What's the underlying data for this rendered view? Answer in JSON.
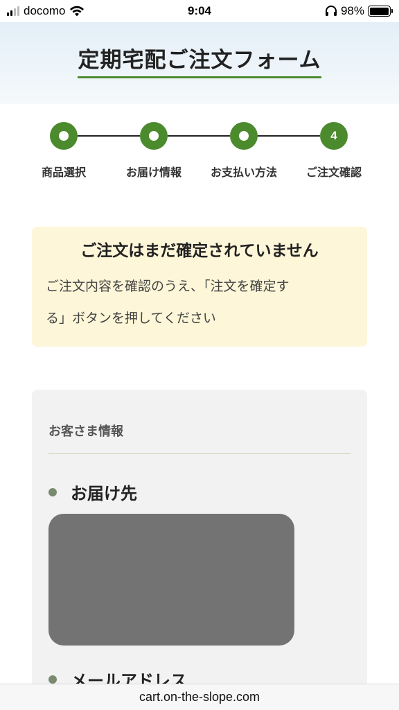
{
  "status_bar": {
    "carrier": "docomo",
    "time": "9:04",
    "battery_percent": "98%",
    "battery_level": 0.98,
    "signal_icon": "signal-bars-icon",
    "wifi_icon": "wifi-icon",
    "headphones_icon": "headphones-icon",
    "battery_icon": "battery-icon"
  },
  "header": {
    "title": "定期宅配ご注文フォーム"
  },
  "steps": [
    {
      "label": "商品選択",
      "state": "completed"
    },
    {
      "label": "お届け情報",
      "state": "completed"
    },
    {
      "label": "お支払い方法",
      "state": "completed"
    },
    {
      "label": "ご注文確認",
      "state": "current",
      "number": "4"
    }
  ],
  "notice": {
    "title": "ご注文はまだ確定されていません",
    "line1": "ご注文内容を確認のうえ、「注文を確定す",
    "line2": "る」ボタンを押してください"
  },
  "customer": {
    "section_title": "お客さま情報",
    "fields": [
      {
        "label": "お届け先"
      },
      {
        "label": "メールアドレス"
      }
    ]
  },
  "browser": {
    "url": "cart.on-the-slope.com"
  },
  "colors": {
    "accent": "#4c8a2e",
    "notice_bg": "#fdf6d8",
    "card_bg": "#f2f2f2",
    "redacted": "#737373"
  }
}
